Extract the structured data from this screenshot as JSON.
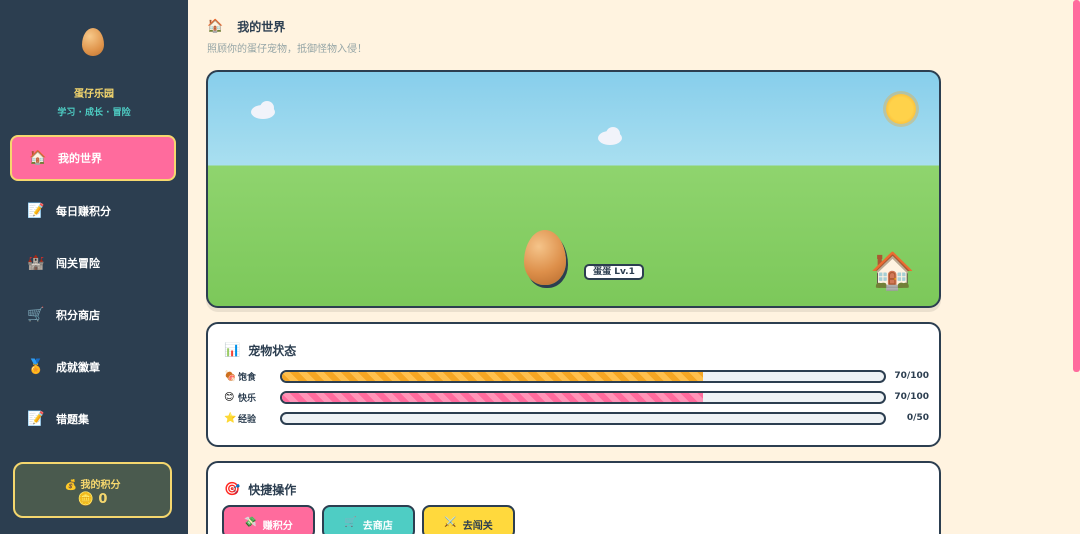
{
  "sidebar": {
    "logo_icon": "egg-icon",
    "brand": "蛋仔乐园",
    "tagline": "学习 · 成长 · 冒险",
    "items": [
      {
        "icon": "🏠",
        "icon_name": "house-icon",
        "label": "我的世界",
        "active": true
      },
      {
        "icon": "📝",
        "icon_name": "memo-icon",
        "label": "每日赚积分",
        "active": false
      },
      {
        "icon": "🏰",
        "icon_name": "castle-icon",
        "label": "闯关冒险",
        "active": false
      },
      {
        "icon": "🛒",
        "icon_name": "cart-icon",
        "label": "积分商店",
        "active": false
      },
      {
        "icon": "🏅",
        "icon_name": "medal-icon",
        "label": "成就徽章",
        "active": false
      },
      {
        "icon": "📝",
        "icon_name": "memo-icon",
        "label": "错题集",
        "active": false
      }
    ],
    "points": {
      "icon": "💰",
      "label": "我的积分",
      "value": "0"
    }
  },
  "header": {
    "icon": "🏠",
    "title": "我的世界",
    "subtitle": "照顾你的蛋仔宠物，抵御怪物入侵！"
  },
  "scene": {
    "pet_label": "蛋蛋 Lv.1",
    "house_icon": "🏠"
  },
  "status": {
    "icon": "📊",
    "title": "宠物状态",
    "stats": [
      {
        "icon": "🍖",
        "label": "饱食",
        "value": "70/100",
        "level": 0.7,
        "color": "orange"
      },
      {
        "icon": "😊",
        "label": "快乐",
        "value": "70/100",
        "level": 0.7,
        "color": "pink"
      },
      {
        "icon": "⭐",
        "label": "经验",
        "value": "0/50",
        "level": 0,
        "color": "gold"
      }
    ]
  },
  "quick": {
    "icon": "🎯",
    "title": "快捷操作",
    "buttons": [
      {
        "icon": "💸",
        "label": "赚积分",
        "color": "#ff6b9d"
      },
      {
        "icon": "🛒",
        "label": "去商店",
        "color": "#4ecdc4"
      },
      {
        "icon": "⚔️",
        "label": "去闯关",
        "color": "#ffd93d"
      }
    ]
  }
}
